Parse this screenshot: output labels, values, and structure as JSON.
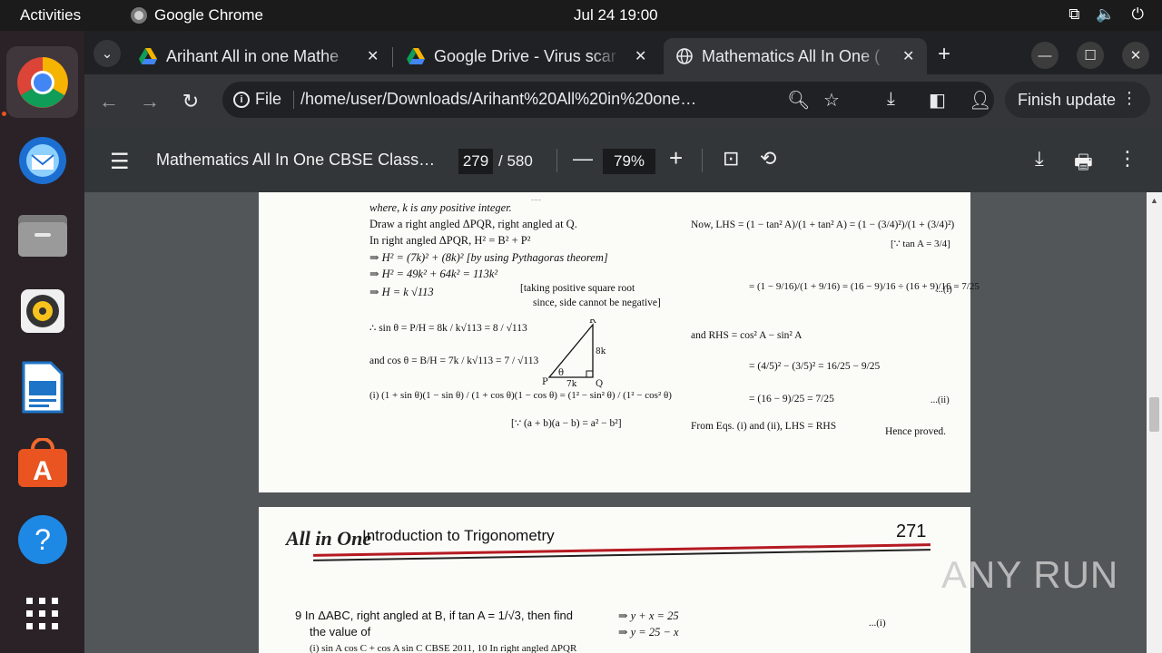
{
  "topbar": {
    "activities": "Activities",
    "app_name": "Google Chrome",
    "clock": "Jul 24  19:00"
  },
  "dock": {
    "items": [
      "chrome",
      "thunderbird",
      "files",
      "rhythmbox",
      "libreoffice-writer",
      "app-center",
      "help",
      "show-apps"
    ]
  },
  "tabs": [
    {
      "title": "Arihant All in one Mathe",
      "icon": "google-drive-icon"
    },
    {
      "title": "Google Drive - Virus scar",
      "icon": "google-drive-icon"
    },
    {
      "title": "Mathematics All In One (",
      "icon": "globe-icon",
      "active": true
    }
  ],
  "toolbar": {
    "scheme_label": "File",
    "url": "/home/user/Downloads/Arihant%20All%20in%20one%20Mathe...",
    "finish_update": "Finish update"
  },
  "pdf": {
    "title": "Mathematics All In One CBSE Class 1...",
    "current_page": "279",
    "total_pages": "/ 580",
    "zoom": "79%"
  },
  "page1": {
    "left": [
      "where, k is any positive integer.",
      "Draw a right angled ΔPQR, right angled at Q.",
      "In right angled ΔPQR, H² = B² + P²",
      "⇒    H² = (7k)² + (8k)²   [by using Pythagoras theorem]",
      "⇒    H² = 49k² + 64k² = 113k²",
      "⇒    H = k √113",
      "[taking positive square root",
      "since, side cannot be negative]",
      "∴   sin θ = P/H = 8k / k√113 = 8 / √113",
      "and cos θ = B/H = 7k / k√113 = 7 / √113",
      "(i)    (1 + sin θ)(1 − sin θ) / (1 + cos θ)(1 − cos θ) = (1² − sin² θ) / (1² − cos² θ)",
      "[∵ (a + b)(a − b) = a² − b²]"
    ],
    "right": [
      "Now,  LHS = (1 − tan² A)/(1 + tan² A) = (1 − (3/4)²)/(1 + (3/4)²)",
      "[∵ tan A = 3/4]",
      "= (1 − 9/16)/(1 + 9/16) = (16 − 9)/16 ÷ (16 + 9)/16 = 7/25",
      "...(i)",
      "and   RHS = cos² A − sin² A",
      "= (4/5)² − (3/5)² = 16/25 − 9/25",
      "= (16 − 9)/25 = 7/25",
      "...(ii)",
      "From Eqs. (i) and (ii), LHS = RHS",
      "Hence proved."
    ],
    "triangle": {
      "P": "P",
      "Q": "Q",
      "R": "R",
      "theta": "θ",
      "side_b": "7k",
      "side_p": "8k"
    }
  },
  "page2": {
    "logo": "All in One",
    "chapter": "Introduction to Trigonometry",
    "page_number": "271",
    "q9": "9  In ΔABC, right angled at B, if tan A = 1/√3, then find",
    "q9b": "the value of",
    "right1": "⇒             y + x = 25",
    "right2": "⇒             y = 25 − x",
    "right3": "...(i)",
    "bottom": "(i)  sin A cos C + cos A sin C          CBSE 2011, 10          In right angled ΔPQR"
  },
  "watermark": "ANY RUN"
}
